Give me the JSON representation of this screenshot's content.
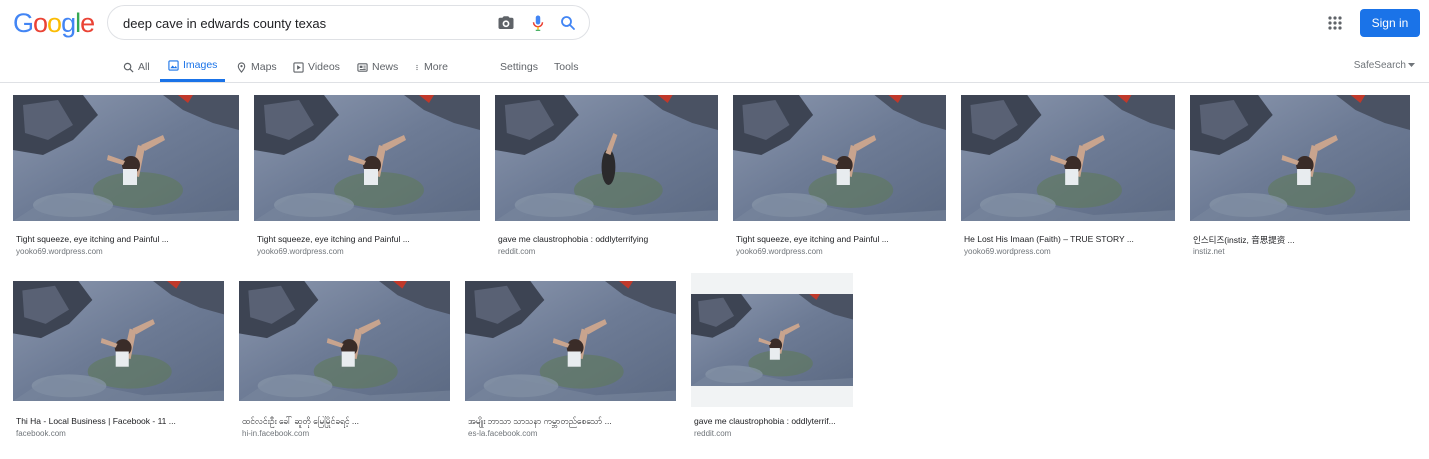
{
  "logo": {
    "letters": [
      "G",
      "o",
      "o",
      "g",
      "l",
      "e"
    ],
    "colors": [
      "#4285f4",
      "#ea4335",
      "#fbbc05",
      "#4285f4",
      "#34a853",
      "#ea4335"
    ]
  },
  "search": {
    "query": "deep cave in edwards county texas"
  },
  "header": {
    "signin_label": "Sign in"
  },
  "tabs": [
    {
      "label": "All",
      "icon": "search-icon"
    },
    {
      "label": "Images",
      "icon": "image-icon",
      "active": true
    },
    {
      "label": "Maps",
      "icon": "map-pin-icon"
    },
    {
      "label": "Videos",
      "icon": "play-icon"
    },
    {
      "label": "News",
      "icon": "newspaper-icon"
    },
    {
      "label": "More",
      "icon": "more-vertical-icon"
    }
  ],
  "tools": {
    "settings": "Settings",
    "tools": "Tools",
    "safesearch": "SafeSearch"
  },
  "results": [
    {
      "title": "Tight squeeze, eye itching and Painful ...",
      "source": "yooko69.wordpress.com"
    },
    {
      "title": "Tight squeeze, eye itching and Painful ...",
      "source": "yooko69.wordpress.com"
    },
    {
      "title": "gave me claustrophobia : oddlyterrifying",
      "source": "reddit.com"
    },
    {
      "title": "Tight squeeze, eye itching and Painful ...",
      "source": "yooko69.wordpress.com"
    },
    {
      "title": "He Lost His Imaan (Faith) – TRUE STORY ...",
      "source": "yooko69.wordpress.com"
    },
    {
      "title": "인스티즈(instiz, 音思提资 ...",
      "source": "instiz.net"
    },
    {
      "title": "Thi Ha - Local Business | Facebook - 11 ...",
      "source": "facebook.com"
    },
    {
      "title": "ထင်လင်းဦး ခေါ် ဆူတို မြေမြိုင်ခရင့် ...",
      "source": "hi-in.facebook.com"
    },
    {
      "title": "အမျိုး ဘာသာ သာသနာ ကမ္ဘာတည်စေသော် ...",
      "source": "es-la.facebook.com"
    },
    {
      "title": "gave me claustrophobia : oddlyterrif...",
      "source": "reddit.com"
    }
  ],
  "colors": {
    "accent": "#1a73e8",
    "link_gray": "#5f6368"
  }
}
